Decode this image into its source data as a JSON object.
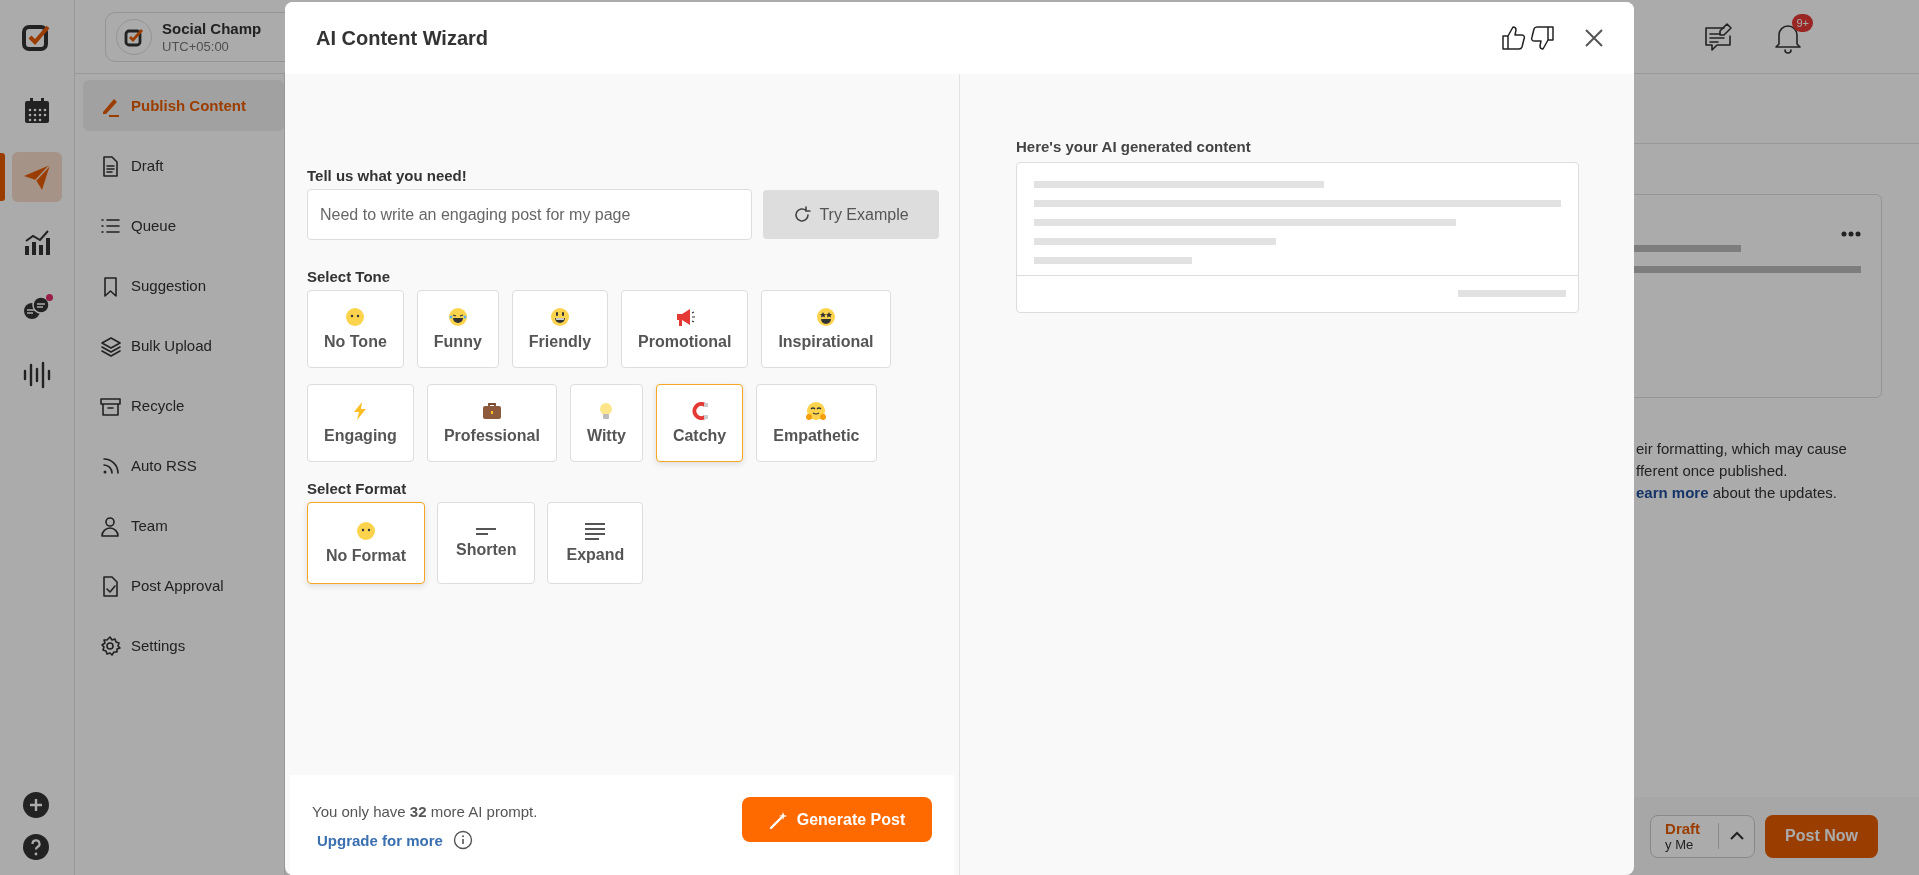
{
  "rail_items": [
    {
      "selected": false,
      "unread": false
    },
    {
      "selected": true,
      "unread": false
    },
    {
      "selected": false,
      "unread": false
    },
    {
      "selected": false,
      "unread": true
    },
    {
      "selected": false,
      "unread": false
    }
  ],
  "account": {
    "name": "Social Champ",
    "timezone": "UTC+05:00"
  },
  "nav": [
    {
      "label": "Publish Content",
      "selected": true
    },
    {
      "label": "Draft",
      "selected": false
    },
    {
      "label": "Queue",
      "selected": false
    },
    {
      "label": "Suggestion",
      "selected": false
    },
    {
      "label": "Bulk Upload",
      "selected": false
    },
    {
      "label": "Recycle",
      "selected": false
    },
    {
      "label": "Auto RSS",
      "selected": false
    },
    {
      "label": "Team",
      "selected": false
    },
    {
      "label": "Post Approval",
      "selected": false
    },
    {
      "label": "Settings",
      "selected": false
    }
  ],
  "notification_count": "9+",
  "notice": {
    "line_1": "eir formatting, which may cause",
    "line_2": "fferent once published.",
    "link": "earn more",
    "line_3_rest": "about the updates."
  },
  "bottom_bar": {
    "draft_label": "Draft",
    "draft_sub": "y Me",
    "post_button": "Post Now"
  },
  "modal": {
    "title": "AI Content Wizard",
    "prompt_label": "Tell us what you need!",
    "prompt_placeholder": "Need to write an engaging post for my page",
    "try_example": "Try Example",
    "tone_label": "Select Tone",
    "tone_rows": [
      [
        {
          "label": "No Tone",
          "selected": false
        },
        {
          "label": "Funny",
          "selected": false
        },
        {
          "label": "Friendly",
          "selected": false
        },
        {
          "label": "Promotional",
          "selected": false
        },
        {
          "label": "Inspirational",
          "selected": false
        }
      ],
      [
        {
          "label": "Engaging",
          "selected": false
        },
        {
          "label": "Professional",
          "selected": false
        },
        {
          "label": "Witty",
          "selected": false
        },
        {
          "label": "Catchy",
          "selected": true
        },
        {
          "label": "Empathetic",
          "selected": false
        }
      ]
    ],
    "format_label": "Select Format",
    "formats": [
      {
        "label": "No Format",
        "selected": true
      },
      {
        "label": "Shorten",
        "selected": false
      },
      {
        "label": "Expand",
        "selected": false
      }
    ],
    "quota_text": "You only have **32** more AI prompt.",
    "upgrade_link": "Upgrade for more",
    "generate_button": "Generate Post",
    "result_label": "Here's your AI generated content"
  }
}
